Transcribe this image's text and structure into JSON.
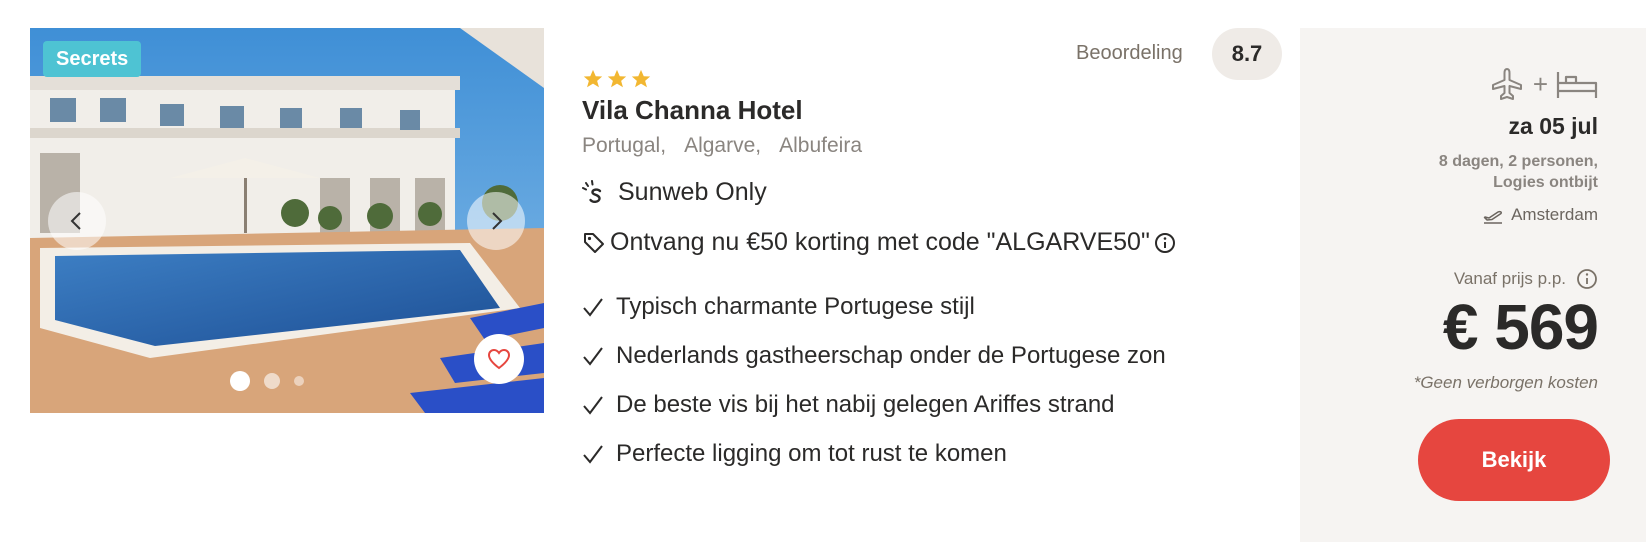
{
  "gallery": {
    "badge": "Secrets",
    "prev_icon": "chevron-left-icon",
    "next_icon": "chevron-right-icon",
    "favorite_icon": "heart-icon",
    "slide_count": 3,
    "active_slide": 1
  },
  "hotel": {
    "stars": 3,
    "star_color": "#f2b731",
    "name": "Vila Channa Hotel",
    "location": [
      "Portugal,",
      "Algarve,",
      "Albufeira"
    ],
    "rating_label": "Beoordeling",
    "rating_value": "8.7",
    "sunweb_only": "Sunweb Only",
    "promo": "Ontvang nu €50 korting met code \"ALGARVE50\"",
    "features": [
      "Typisch charmante Portugese stijl",
      "Nederlands gastheerschap onder de Portugese zon",
      "De beste vis bij het nabij gelegen Ariffes strand",
      "Perfecte ligging om tot rust te komen"
    ]
  },
  "offer": {
    "transport_plus": "+",
    "date": "za 05 jul",
    "duration_line1": "8 dagen, 2 personen,",
    "duration_line2": "Logies ontbijt",
    "departure": "Amsterdam",
    "from_label": "Vanaf prijs p.p.",
    "price": "€ 569",
    "no_costs": "*Geen verborgen kosten",
    "cta": "Bekijk",
    "cta_color": "#e6463f"
  }
}
